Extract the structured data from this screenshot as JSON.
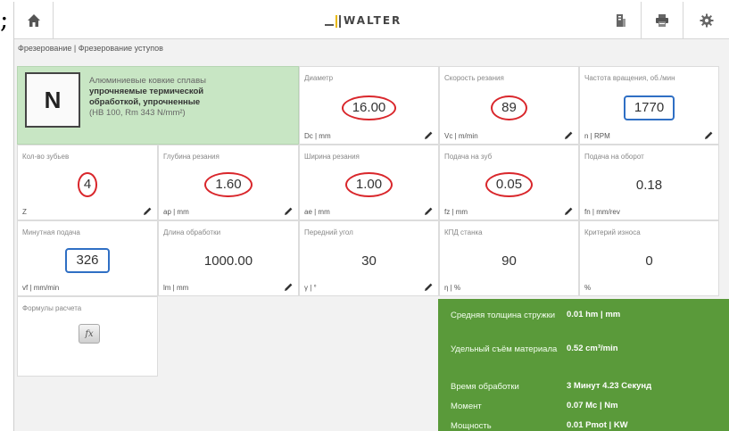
{
  "fragment_text": ";",
  "app": {
    "logo_text": "WALTER",
    "breadcrumb": "Фрезерование | Фрезерование уступов"
  },
  "icons": {
    "home": "home-icon",
    "document": "document-icon",
    "print": "print-icon",
    "settings": "gear-icon",
    "edit": "pencil-icon",
    "formula": "fx-icon"
  },
  "material": {
    "group": "N",
    "line1": "Алюминиевые ковкие сплавы",
    "line2": "упрочняемые термической обработкой, упрочненные",
    "line3": "(HB 100, Rm 343 N/mm²)"
  },
  "params": {
    "diameter": {
      "label": "Диаметр",
      "value": "16.00",
      "unit": "Dc | mm"
    },
    "cutting_speed": {
      "label": "Скорость резания",
      "value": "89",
      "unit": "Vc | m/min"
    },
    "spindle_speed": {
      "label": "Частота вращения, об./мин",
      "value": "1770",
      "unit": "n | RPM"
    },
    "teeth": {
      "label": "Кол-во зубьев",
      "value": "4",
      "unit": "Z"
    },
    "depth": {
      "label": "Глубина резания",
      "value": "1.60",
      "unit": "ap | mm"
    },
    "width": {
      "label": "Ширина резания",
      "value": "1.00",
      "unit": "ae | mm"
    },
    "feed_tooth": {
      "label": "Подача на зуб",
      "value": "0.05",
      "unit": "fz | mm"
    },
    "feed_rev": {
      "label": "Подача на оборот",
      "value": "0.18",
      "unit": "fn | mm/rev"
    },
    "feed_min": {
      "label": "Минутная подача",
      "value": "326",
      "unit": "vf | mm/min"
    },
    "length": {
      "label": "Длина обработки",
      "value": "1000.00",
      "unit": "lm | mm"
    },
    "rake_angle": {
      "label": "Передний угол",
      "value": "30",
      "unit": "γ | °"
    },
    "efficiency": {
      "label": "КПД станка",
      "value": "90",
      "unit": "η | %"
    },
    "wear": {
      "label": "Критерий износа",
      "value": "0",
      "unit": "%"
    }
  },
  "formulas": {
    "label": "Формулы расчета",
    "button": "fx"
  },
  "results": [
    {
      "label": "Средняя толщина стружки",
      "value": "0.01 hm | mm"
    },
    {
      "label": "Удельный съём материала",
      "value": "0.52 cm³/min"
    },
    {
      "label": "Время обработки",
      "value": "3 Минут 4.23 Секунд"
    },
    {
      "label": "Момент",
      "value": "0.07 Mc | Nm"
    },
    {
      "label": "Мощность",
      "value": "0.01 Pmot | KW"
    }
  ],
  "colors": {
    "material_bg": "#c8e6c4",
    "results_bg": "#5a9a3a",
    "mark_red": "#d9262b",
    "mark_blue": "#2f6fc4"
  }
}
